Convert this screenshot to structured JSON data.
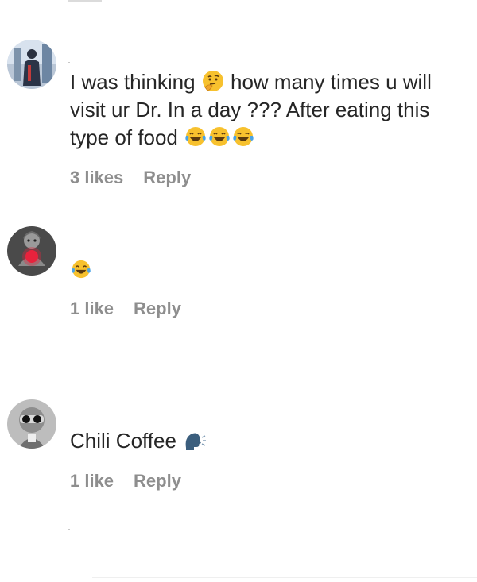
{
  "comments": [
    {
      "avatar_icon": "user-avatar-dark-figure",
      "text_parts": [
        "I was thinking",
        "how many times u will visit ur Dr. In a day ??? After eating this type of food"
      ],
      "emojis": [
        "thinking-face-emoji",
        "tears-of-joy-emoji",
        "tears-of-joy-emoji",
        "tears-of-joy-emoji"
      ],
      "likes": "3 likes",
      "reply": "Reply"
    },
    {
      "avatar_icon": "user-avatar-doll-red",
      "text_parts": [],
      "emojis": [
        "tears-of-joy-emoji"
      ],
      "likes": "1 like",
      "reply": "Reply"
    },
    {
      "avatar_icon": "user-avatar-sunglasses",
      "text_parts": [
        "Chili Coffee"
      ],
      "emojis": [
        "speaking-head-emoji"
      ],
      "likes": "1 like",
      "reply": "Reply"
    }
  ],
  "colors": {
    "text": "#262626",
    "meta": "#8e8e8e",
    "emoji_yellow": "#f7c12e",
    "speaking_head": "#3b5e7d"
  }
}
